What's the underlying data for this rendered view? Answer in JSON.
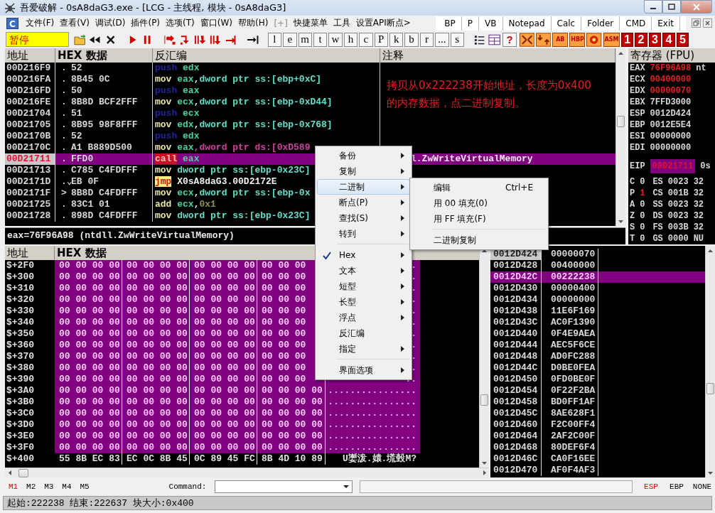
{
  "window": {
    "title": "吾爱破解 - 0sA8daG3.exe - [LCG - 主线程, 模块 - 0sA8daG3]"
  },
  "menubar": {
    "logo": "C",
    "menus": [
      {
        "label": "文件(F)",
        "disabled": false
      },
      {
        "label": "查看(V)",
        "disabled": false
      },
      {
        "label": "调试(D)",
        "disabled": false
      },
      {
        "label": "插件(P)",
        "disabled": false
      },
      {
        "label": "选项(T)",
        "disabled": false
      },
      {
        "label": "窗口(W)",
        "disabled": false
      },
      {
        "label": "帮助(H)",
        "disabled": false
      },
      {
        "label": "[+]",
        "disabled": true
      },
      {
        "label": "快捷菜单",
        "disabled": false
      },
      {
        "label": "工具",
        "disabled": false
      },
      {
        "label": "设置API断点>",
        "disabled": false
      }
    ],
    "quick_buttons": [
      "BP",
      "P",
      "VB",
      "Notepad",
      "Calc",
      "Folder",
      "CMD",
      "Exit"
    ]
  },
  "toolbar": {
    "status": "暂停",
    "letter_buttons": [
      "l",
      "e",
      "m",
      "t",
      "w",
      "h",
      "c",
      "P",
      "k",
      "b",
      "r",
      "...",
      "s"
    ],
    "help": "?",
    "plugin_buttons": [
      "AB",
      "HBP",
      "ASM"
    ],
    "window_buttons": [
      "1",
      "2",
      "3",
      "4",
      "5"
    ]
  },
  "cpu": {
    "columns": [
      "地址",
      "HEX 数据",
      "反汇编",
      "注释"
    ],
    "rows": [
      {
        "address": "00D216F9",
        "marker": ".",
        "hex": "52",
        "mnemonic": "push",
        "kind": "push",
        "operands": [
          {
            "text": "edx",
            "kind": "reg"
          }
        ],
        "selected": false
      },
      {
        "address": "00D216FA",
        "marker": ".",
        "hex": "8B45 0C",
        "mnemonic": "mov",
        "kind": "mov",
        "operands": [
          {
            "text": "eax",
            "kind": "reg"
          },
          {
            "text": ",",
            "kind": "sep"
          },
          {
            "text": "dword ptr ss:[ebp+0xC]",
            "kind": "mem"
          }
        ],
        "selected": false
      },
      {
        "address": "00D216FD",
        "marker": ".",
        "hex": "50",
        "mnemonic": "push",
        "kind": "push",
        "operands": [
          {
            "text": "eax",
            "kind": "reg"
          }
        ],
        "selected": false
      },
      {
        "address": "00D216FE",
        "marker": ".",
        "hex": "8B8D BCF2FFF",
        "mnemonic": "mov",
        "kind": "mov",
        "operands": [
          {
            "text": "ecx",
            "kind": "reg"
          },
          {
            "text": ",",
            "kind": "sep"
          },
          {
            "text": "dword ptr ss:[ebp-0xD44]",
            "kind": "mem"
          }
        ],
        "selected": false
      },
      {
        "address": "00D21704",
        "marker": ".",
        "hex": "51",
        "mnemonic": "push",
        "kind": "push",
        "operands": [
          {
            "text": "ecx",
            "kind": "reg"
          }
        ],
        "selected": false
      },
      {
        "address": "00D21705",
        "marker": ".",
        "hex": "8B95 98F8FFF",
        "mnemonic": "mov",
        "kind": "mov",
        "operands": [
          {
            "text": "edx",
            "kind": "reg"
          },
          {
            "text": ",",
            "kind": "sep"
          },
          {
            "text": "dword ptr ss:[ebp-0x768]",
            "kind": "mem"
          }
        ],
        "selected": false
      },
      {
        "address": "00D2170B",
        "marker": ".",
        "hex": "52",
        "mnemonic": "push",
        "kind": "push",
        "operands": [
          {
            "text": "edx",
            "kind": "reg"
          }
        ],
        "selected": false
      },
      {
        "address": "00D2170C",
        "marker": ".",
        "hex": "A1 B889D500",
        "mnemonic": "mov",
        "kind": "mov",
        "operands": [
          {
            "text": "eax",
            "kind": "reg"
          },
          {
            "text": ",dword ptr ds:[0xD589",
            "kind": "memds"
          }
        ],
        "selected": false
      },
      {
        "address": "00D21711",
        "marker": ".",
        "hex": "FFD0",
        "mnemonic": "call",
        "kind": "call",
        "operands": [
          {
            "text": "eax",
            "kind": "reg"
          }
        ],
        "comment": "l.ZwWriteVirtualMemory",
        "selected": true
      },
      {
        "address": "00D21713",
        "marker": ".",
        "hex": "C785 C4FDFFF",
        "mnemonic": "mov",
        "kind": "mov",
        "operands": [
          {
            "text": "dword ptr ss:[ebp-0x23C]",
            "kind": "mem"
          }
        ],
        "selected": false
      },
      {
        "address": "00D2171D",
        "marker": ".⌄",
        "hex": "EB 0F",
        "mnemonic": "jmp",
        "kind": "jmp",
        "operands": [
          {
            "text": "X0sA8daG3.00D2172E",
            "kind": "label"
          }
        ],
        "selected": false
      },
      {
        "address": "00D2171F",
        "marker": ">",
        "hex": "8B8D C4FDFFF",
        "mnemonic": "mov",
        "kind": "mov",
        "operands": [
          {
            "text": "ecx",
            "kind": "reg"
          },
          {
            "text": ",",
            "kind": "sep"
          },
          {
            "text": "dword ptr ss:[ebp-0x",
            "kind": "mem"
          }
        ],
        "selected": false
      },
      {
        "address": "00D21725",
        "marker": ".",
        "hex": "83C1 01",
        "mnemonic": "add",
        "kind": "mov",
        "operands": [
          {
            "text": "ecx",
            "kind": "reg"
          },
          {
            "text": ",",
            "kind": "sep"
          },
          {
            "text": "0x1",
            "kind": "const"
          }
        ],
        "selected": false
      },
      {
        "address": "00D21728",
        "marker": ".",
        "hex": "898D C4FDFFF",
        "mnemonic": "mov",
        "kind": "mov",
        "operands": [
          {
            "text": "dword ptr ss:[ebp-0x23C]",
            "kind": "mem"
          }
        ],
        "selected": false
      }
    ],
    "note": [
      "拷贝从0x222238开始地址，长度为0x400",
      "的内存数据，点二进制复制。"
    ],
    "info": "eax=76F96A98 (ntdll.ZwWriteVirtualMemory)"
  },
  "registers": {
    "title": "寄存器 (FPU)",
    "general": [
      {
        "name": "EAX",
        "value": "76F96A98",
        "note": "nt",
        "changed": true
      },
      {
        "name": "ECX",
        "value": "00400000",
        "changed": true
      },
      {
        "name": "EDX",
        "value": "00000070",
        "changed": true
      },
      {
        "name": "EBX",
        "value": "7FFD3000",
        "changed": false
      },
      {
        "name": "ESP",
        "value": "0012D424",
        "changed": false
      },
      {
        "name": "EBP",
        "value": "0012E5E4",
        "changed": false
      },
      {
        "name": "ESI",
        "value": "00000000",
        "changed": false
      },
      {
        "name": "EDI",
        "value": "00000000",
        "changed": false
      }
    ],
    "eip": {
      "name": "EIP",
      "value": "00D21711",
      "note": "0s"
    },
    "flags": [
      {
        "flag": "C",
        "value": "0",
        "changed": false,
        "segment": "ES",
        "selector": "0023",
        "bits": "32"
      },
      {
        "flag": "P",
        "value": "1",
        "changed": true,
        "segment": "CS",
        "selector": "001B",
        "bits": "32"
      },
      {
        "flag": "A",
        "value": "0",
        "changed": false,
        "segment": "SS",
        "selector": "0023",
        "bits": "32"
      },
      {
        "flag": "Z",
        "value": "0",
        "changed": false,
        "segment": "DS",
        "selector": "0023",
        "bits": "32"
      },
      {
        "flag": "S",
        "value": "0",
        "changed": false,
        "segment": "FS",
        "selector": "003B",
        "bits": "32"
      },
      {
        "flag": "T",
        "value": "0",
        "changed": false,
        "segment": "GS",
        "selector": "0000",
        "bits": "NU"
      }
    ]
  },
  "dump": {
    "columns": [
      "地址",
      "HEX 数据"
    ],
    "rows": [
      {
        "address": "$+2F0",
        "groups": [
          "00 00 00 00",
          "00 00 00 00",
          "00 00 00 00",
          "00 00 00"
        ],
        "ascii": "..",
        "selected": true
      },
      {
        "address": "$+300",
        "groups": [
          "00 00 00 00",
          "00 00 00 00",
          "00 00 00 00",
          "00 00 00"
        ],
        "ascii": "..",
        "selected": true
      },
      {
        "address": "$+310",
        "groups": [
          "00 00 00 00",
          "00 00 00 00",
          "00 00 00 00",
          "00 00 00"
        ],
        "ascii": "..",
        "selected": true
      },
      {
        "address": "$+320",
        "groups": [
          "00 00 00 00",
          "00 00 00 00",
          "00 00 00 00",
          "00 00 00"
        ],
        "ascii": "..",
        "selected": true
      },
      {
        "address": "$+330",
        "groups": [
          "00 00 00 00",
          "00 00 00 00",
          "00 00 00 00",
          "00 00 00"
        ],
        "ascii": "..",
        "selected": true
      },
      {
        "address": "$+340",
        "groups": [
          "00 00 00 00",
          "00 00 00 00",
          "00 00 00 00",
          "00 00 00"
        ],
        "ascii": "..",
        "selected": true
      },
      {
        "address": "$+350",
        "groups": [
          "00 00 00 00",
          "00 00 00 00",
          "00 00 00 00",
          "00 00 00"
        ],
        "ascii": "..",
        "selected": true
      },
      {
        "address": "$+360",
        "groups": [
          "00 00 00 00",
          "00 00 00 00",
          "00 00 00 00",
          "00 00 00"
        ],
        "ascii": "..",
        "selected": true
      },
      {
        "address": "$+370",
        "groups": [
          "00 00 00 00",
          "00 00 00 00",
          "00 00 00 00",
          "00 00 00"
        ],
        "ascii": "..",
        "selected": true
      },
      {
        "address": "$+380",
        "groups": [
          "00 00 00 00",
          "00 00 00 00",
          "00 00 00 00",
          "00 00 00"
        ],
        "ascii": "..",
        "selected": true
      },
      {
        "address": "$+390",
        "groups": [
          "00 00 00 00",
          "00 00 00 00",
          "00 00 00 00",
          "00 00 00"
        ],
        "ascii": "..",
        "selected": true
      },
      {
        "address": "$+3A0",
        "groups": [
          "00 00 00 00",
          "00 00 00 00",
          "00 00 00 00",
          "00 00 00 00"
        ],
        "ascii": "................",
        "selected": true
      },
      {
        "address": "$+3B0",
        "groups": [
          "00 00 00 00",
          "00 00 00 00",
          "00 00 00 00",
          "00 00 00 00"
        ],
        "ascii": "................",
        "selected": true
      },
      {
        "address": "$+3C0",
        "groups": [
          "00 00 00 00",
          "00 00 00 00",
          "00 00 00 00",
          "00 00 00 00"
        ],
        "ascii": "................",
        "selected": true
      },
      {
        "address": "$+3D0",
        "groups": [
          "00 00 00 00",
          "00 00 00 00",
          "00 00 00 00",
          "00 00 00 00"
        ],
        "ascii": "................",
        "selected": true
      },
      {
        "address": "$+3E0",
        "groups": [
          "00 00 00 00",
          "00 00 00 00",
          "00 00 00 00",
          "00 00 00 00"
        ],
        "ascii": "................",
        "selected": true
      },
      {
        "address": "$+3F0",
        "groups": [
          "00 00 00 00",
          "00 00 00 00",
          "00 00 00 00",
          "00 00 00 00"
        ],
        "ascii": "................",
        "selected": true
      },
      {
        "address": "$+400",
        "groups": [
          "55 8B EC 83",
          "EC 0C 8B 45",
          "0C 89 45 FC",
          "8B 4D 10 89"
        ],
        "ascii": "U嬱泼.媴.塃瑴M?",
        "selected": false
      }
    ]
  },
  "stack": {
    "rows": [
      {
        "address": "0012D424",
        "value": "00000070",
        "esp": true,
        "selected": false
      },
      {
        "address": "0012D428",
        "value": "00400000",
        "esp": false,
        "selected": false
      },
      {
        "address": "0012D42C",
        "value": "00222238",
        "esp": false,
        "selected": true
      },
      {
        "address": "0012D430",
        "value": "00000400",
        "esp": false,
        "selected": false
      },
      {
        "address": "0012D434",
        "value": "00000000",
        "esp": false,
        "selected": false
      },
      {
        "address": "0012D438",
        "value": "11E6F169",
        "esp": false,
        "selected": false
      },
      {
        "address": "0012D43C",
        "value": "AC0F1390",
        "esp": false,
        "selected": false
      },
      {
        "address": "0012D440",
        "value": "0F4E9AEA",
        "esp": false,
        "selected": false
      },
      {
        "address": "0012D444",
        "value": "AEC5F6CE",
        "esp": false,
        "selected": false
      },
      {
        "address": "0012D448",
        "value": "AD0FC288",
        "esp": false,
        "selected": false
      },
      {
        "address": "0012D44C",
        "value": "D0BE0FEA",
        "esp": false,
        "selected": false
      },
      {
        "address": "0012D450",
        "value": "0FD0BE0F",
        "esp": false,
        "selected": false
      },
      {
        "address": "0012D454",
        "value": "0F22F2BA",
        "esp": false,
        "selected": false
      },
      {
        "address": "0012D458",
        "value": "BD0FF1AF",
        "esp": false,
        "selected": false
      },
      {
        "address": "0012D45C",
        "value": "8AE628F1",
        "esp": false,
        "selected": false
      },
      {
        "address": "0012D460",
        "value": "F2C00FF4",
        "esp": false,
        "selected": false
      },
      {
        "address": "0012D464",
        "value": "2AF2C00F",
        "esp": false,
        "selected": false
      },
      {
        "address": "0012D468",
        "value": "80DEF6F4",
        "esp": false,
        "selected": false
      },
      {
        "address": "0012D46C",
        "value": "CA0F16EE",
        "esp": false,
        "selected": false
      },
      {
        "address": "0012D470",
        "value": "AF0F4AF3",
        "esp": false,
        "selected": false
      }
    ]
  },
  "command_bar": {
    "marks": [
      {
        "label": "M1",
        "selected": true
      },
      {
        "label": "M2",
        "selected": false
      },
      {
        "label": "M3",
        "selected": false
      },
      {
        "label": "M4",
        "selected": false
      },
      {
        "label": "M5",
        "selected": false
      }
    ],
    "command_label": "Command:",
    "registers": [
      {
        "label": "ESP",
        "selected": true
      },
      {
        "label": "EBP",
        "selected": false
      },
      {
        "label": "NONE",
        "selected": false
      }
    ]
  },
  "status_bar": {
    "text": "起始:222238 结束:222637 块大小:0x400"
  },
  "context_menu": {
    "items": [
      {
        "kind": "item",
        "label": "备份",
        "submenu": true,
        "checked": false,
        "selected": false
      },
      {
        "kind": "item",
        "label": "复制",
        "submenu": true,
        "checked": false,
        "selected": false
      },
      {
        "kind": "item",
        "label": "二进制",
        "submenu": true,
        "checked": false,
        "selected": true
      },
      {
        "kind": "item",
        "label": "断点(P)",
        "submenu": true,
        "checked": false,
        "selected": false
      },
      {
        "kind": "item",
        "label": "查找(S)",
        "submenu": true,
        "checked": false,
        "selected": false
      },
      {
        "kind": "item",
        "label": "转到",
        "submenu": true,
        "checked": false,
        "selected": false
      },
      {
        "kind": "separator"
      },
      {
        "kind": "item",
        "label": "Hex",
        "submenu": true,
        "checked": true,
        "selected": false
      },
      {
        "kind": "item",
        "label": "文本",
        "submenu": true,
        "checked": false,
        "selected": false
      },
      {
        "kind": "item",
        "label": "短型",
        "submenu": true,
        "checked": false,
        "selected": false
      },
      {
        "kind": "item",
        "label": "长型",
        "submenu": true,
        "checked": false,
        "selected": false
      },
      {
        "kind": "item",
        "label": "浮点",
        "submenu": true,
        "checked": false,
        "selected": false
      },
      {
        "kind": "item",
        "label": "反汇编",
        "submenu": false,
        "checked": false,
        "selected": false
      },
      {
        "kind": "item",
        "label": "指定",
        "submenu": true,
        "checked": false,
        "selected": false
      },
      {
        "kind": "separator"
      },
      {
        "kind": "item",
        "label": "界面选项",
        "submenu": true,
        "checked": false,
        "selected": false
      }
    ],
    "submenu": {
      "items": [
        {
          "kind": "item",
          "label": "编辑",
          "shortcut": "Ctrl+E"
        },
        {
          "kind": "item",
          "label": "用 00 填充(0)"
        },
        {
          "kind": "item",
          "label": "用 FF 填充(F)"
        },
        {
          "kind": "separator"
        },
        {
          "kind": "item",
          "label": "二进制复制"
        }
      ]
    }
  }
}
